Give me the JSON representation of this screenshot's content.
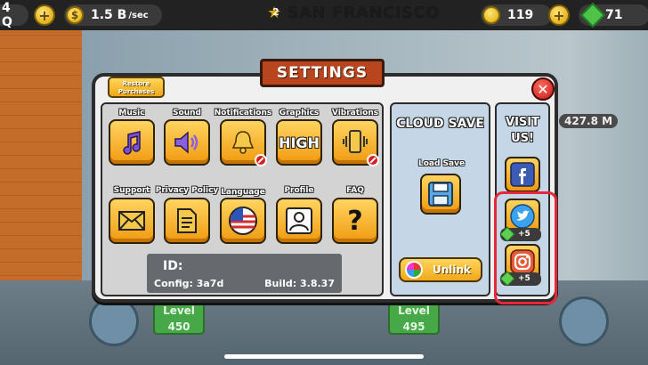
{
  "hud": {
    "left_amount": "4 Q",
    "income": "1.5 B",
    "income_unit": "/sec",
    "city_level": "2",
    "city_name": "SAN FRANCISCO",
    "coins": "119",
    "gems": "71",
    "side_amount": "427.8 M"
  },
  "dialog": {
    "title": "SETTINGS",
    "restore_label": "Restore Purchases",
    "close_icon": "close-icon"
  },
  "settings": {
    "items": [
      {
        "label": "Music",
        "icon": "music-note-icon"
      },
      {
        "label": "Sound",
        "icon": "speaker-icon"
      },
      {
        "label": "Notifications",
        "icon": "bell-icon",
        "disabled": true
      },
      {
        "label": "Graphics",
        "icon": "graphics-text",
        "value": "HIGH"
      },
      {
        "label": "Vibrations",
        "icon": "vibration-icon",
        "disabled": true
      },
      {
        "label": "Support",
        "icon": "envelope-icon"
      },
      {
        "label": "Privacy Policy",
        "icon": "document-icon"
      },
      {
        "label": "Language",
        "icon": "flag-icon"
      },
      {
        "label": "Profile",
        "icon": "user-icon"
      },
      {
        "label": "FAQ",
        "icon": "question-icon",
        "value": "?"
      }
    ]
  },
  "info": {
    "id_label": "ID:",
    "config": "Config: 3a7d",
    "build": "Build: 3.8.37"
  },
  "cloud": {
    "title": "CLOUD SAVE",
    "load_label": "Load Save",
    "unlink_label": "Unlink"
  },
  "visit": {
    "title_line1": "VISIT",
    "title_line2": "US!",
    "socials": [
      {
        "name": "facebook",
        "icon": "facebook-icon"
      },
      {
        "name": "twitter",
        "icon": "twitter-icon",
        "reward": "+5"
      },
      {
        "name": "instagram",
        "icon": "instagram-icon",
        "reward": "+5"
      }
    ]
  },
  "background": {
    "levels": [
      {
        "label": "Level",
        "value": "450"
      },
      {
        "label": "Level",
        "value": "495"
      }
    ]
  },
  "colors": {
    "highlight": "#e8283a",
    "button": "#f0a81a",
    "banner": "#b9451f"
  }
}
